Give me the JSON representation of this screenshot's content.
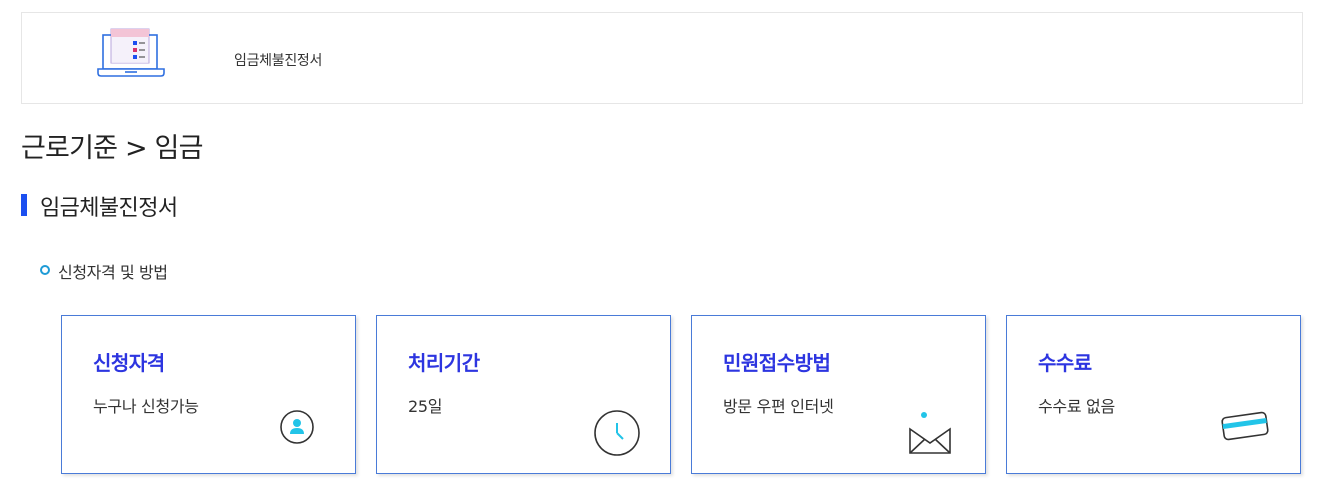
{
  "header": {
    "title": "임금체불진정서",
    "icon": "laptop-document-icon"
  },
  "breadcrumb": "근로기준 > 임금",
  "section": {
    "title": "임금체불진정서"
  },
  "subsection": {
    "title": "신청자격 및 방법"
  },
  "cards": [
    {
      "title": "신청자격",
      "value": "누구나 신청가능",
      "icon": "user-icon"
    },
    {
      "title": "처리기간",
      "value": "25일",
      "icon": "clock-icon"
    },
    {
      "title": "민원접수방법",
      "value": "방문  우편  인터넷",
      "icon": "envelope-icon"
    },
    {
      "title": "수수료",
      "value": "수수료 없음",
      "icon": "card-icon"
    }
  ],
  "colors": {
    "accent_blue": "#1c4ff0",
    "card_title": "#2d35e0",
    "icon_cyan": "#22c4e8",
    "card_border": "#4a7bd8"
  }
}
